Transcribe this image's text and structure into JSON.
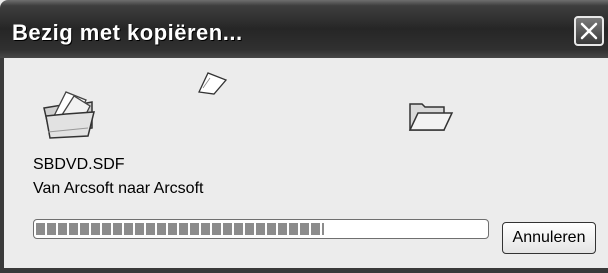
{
  "window": {
    "title": "Bezig met kopiëren...",
    "close_icon": "close-icon"
  },
  "animation": {
    "source_icon": "source-folder-icon",
    "flying_icon": "flying-document-icon",
    "target_icon": "target-folder-icon"
  },
  "copy": {
    "file_name": "SBDVD.SDF",
    "description": "Van Arcsoft naar Arcsoft",
    "progress": 0.64
  },
  "buttons": {
    "cancel_label": "Annuleren"
  },
  "colors": {
    "titlebar": "#262626",
    "body": "#ececec",
    "progress_fill": "#8c8c8c"
  }
}
